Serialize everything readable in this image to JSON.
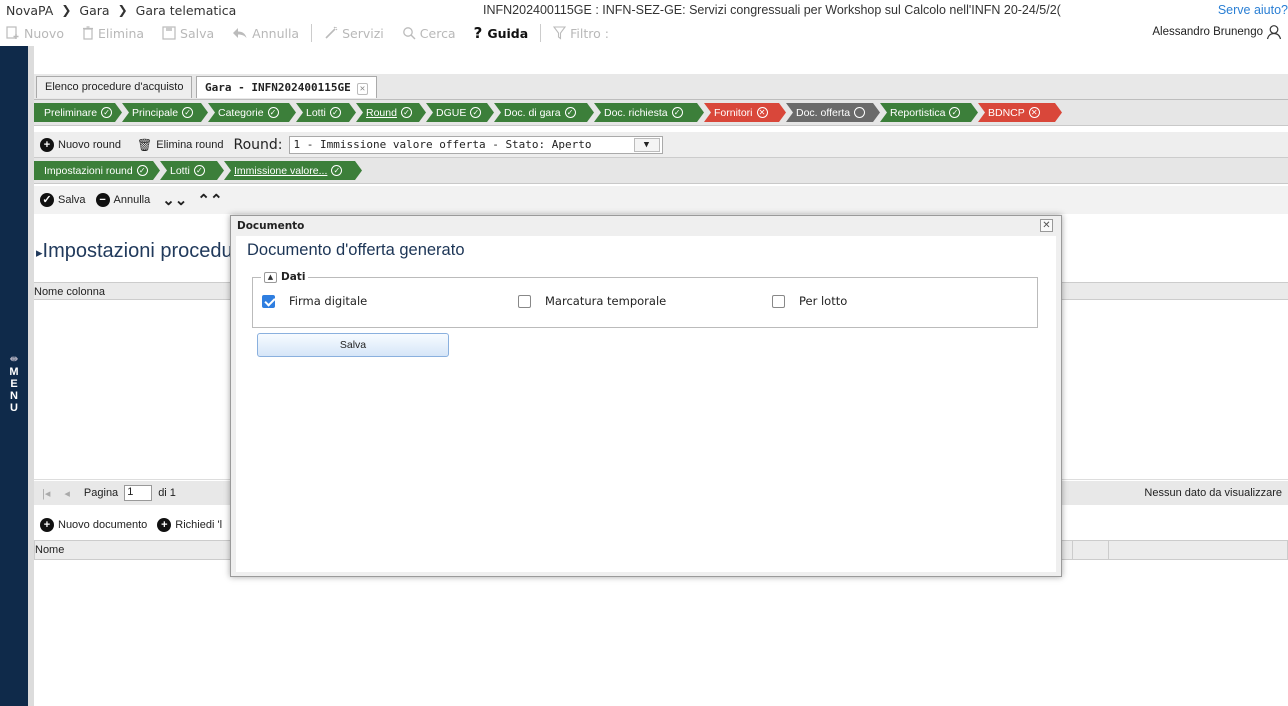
{
  "breadcrumb": {
    "items": [
      "NovaPA",
      "Gara",
      "Gara telematica"
    ]
  },
  "top_title": "INFN202400115GE : INFN-SEZ-GE: Servizi congressuali per Workshop sul Calcolo nell'INFN 20-24/5/2(",
  "help_link": "Serve aiuto?",
  "toolbar": {
    "nuovo": "Nuovo",
    "elimina": "Elimina",
    "salva": "Salva",
    "annulla": "Annulla",
    "servizi": "Servizi",
    "cerca": "Cerca",
    "guida": "Guida",
    "filtro": "Filtro :"
  },
  "user": {
    "name": "Alessandro Brunengo"
  },
  "side_menu": {
    "label": "MENU"
  },
  "tabs": {
    "first": "Elenco procedure d'acquisto",
    "active": "Gara - INFN202400115GE"
  },
  "steps": [
    {
      "label": "Preliminare",
      "status": "ok"
    },
    {
      "label": "Principale",
      "status": "ok"
    },
    {
      "label": "Categorie",
      "status": "ok"
    },
    {
      "label": "Lotti",
      "status": "ok"
    },
    {
      "label": "Round",
      "status": "ok"
    },
    {
      "label": "DGUE",
      "status": "ok"
    },
    {
      "label": "Doc. di gara",
      "status": "ok"
    },
    {
      "label": "Doc. richiesta",
      "status": "ok"
    },
    {
      "label": "Fornitori",
      "status": "error"
    },
    {
      "label": "Doc. offerta",
      "status": "pending"
    },
    {
      "label": "Reportistica",
      "status": "ok"
    },
    {
      "label": "BDNCP",
      "status": "error"
    }
  ],
  "round_bar": {
    "nuovo_round": "Nuovo round",
    "elimina_round": "Elimina round",
    "round_label": "Round:",
    "round_value": "1 - Immissione valore offerta - Stato: Aperto"
  },
  "substeps": [
    "Impostazioni round",
    "Lotti",
    "Immissione valore..."
  ],
  "actions": {
    "salva": "Salva",
    "annulla": "Annulla"
  },
  "section_title": "Impostazioni procedu",
  "list": {
    "col_name": "Nome colonna"
  },
  "pager": {
    "page_label": "Pagina",
    "page_value": "1",
    "of_label": "di 1",
    "empty": "Nessun dato da visualizzare"
  },
  "doc_actions": {
    "nuovo_documento": "Nuovo documento",
    "richiedi": "Richiedi 'l"
  },
  "doc_list": {
    "col_name": "Nome"
  },
  "modal": {
    "header": "Documento",
    "title": "Documento d'offerta generato",
    "fieldset_legend": "Dati",
    "firma_digitale": {
      "label": "Firma digitale",
      "checked": true
    },
    "marcatura_temporale": {
      "label": "Marcatura temporale",
      "checked": false
    },
    "per_lotto": {
      "label": "Per lotto",
      "checked": false
    },
    "save_label": "Salva"
  }
}
